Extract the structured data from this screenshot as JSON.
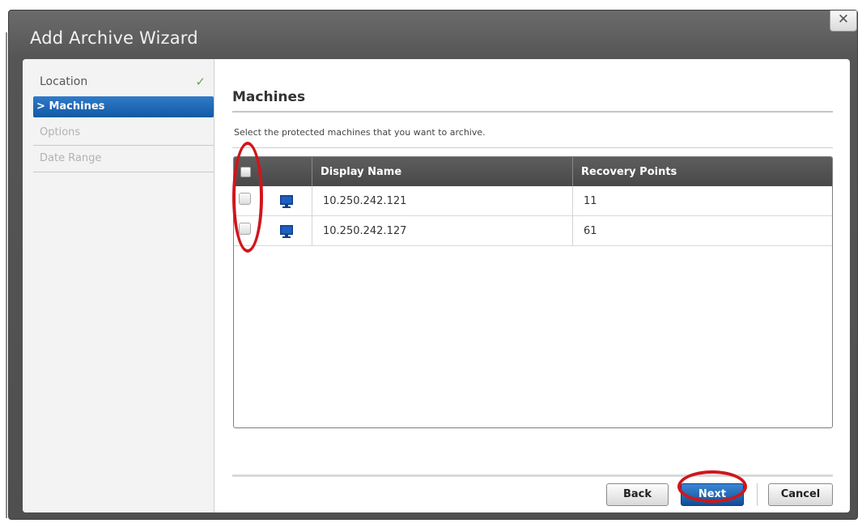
{
  "window": {
    "title": "Add Archive Wizard",
    "close_glyph": "✕"
  },
  "nav": {
    "items": [
      {
        "label": "Location",
        "state": "done",
        "check_glyph": "✓"
      },
      {
        "label": "Machines",
        "state": "active",
        "prefix": ">"
      },
      {
        "label": "Options",
        "state": "pending"
      },
      {
        "label": "Date Range",
        "state": "pending"
      }
    ]
  },
  "section": {
    "title": "Machines",
    "instruction": "Select the protected machines that you want to archive."
  },
  "grid": {
    "columns": [
      "",
      "",
      "Display Name",
      "Recovery Points"
    ],
    "rows": [
      {
        "display_name": "10.250.242.121",
        "recovery_points": "11",
        "icon": "monitor-icon",
        "checked": false
      },
      {
        "display_name": "10.250.242.127",
        "recovery_points": "61",
        "icon": "monitor-icon",
        "checked": false
      }
    ]
  },
  "buttons": {
    "back": "Back",
    "next": "Next",
    "cancel": "Cancel"
  },
  "colors": {
    "accent": "#125aa4",
    "annotation": "#d0161b",
    "header_bg": "#484848"
  }
}
